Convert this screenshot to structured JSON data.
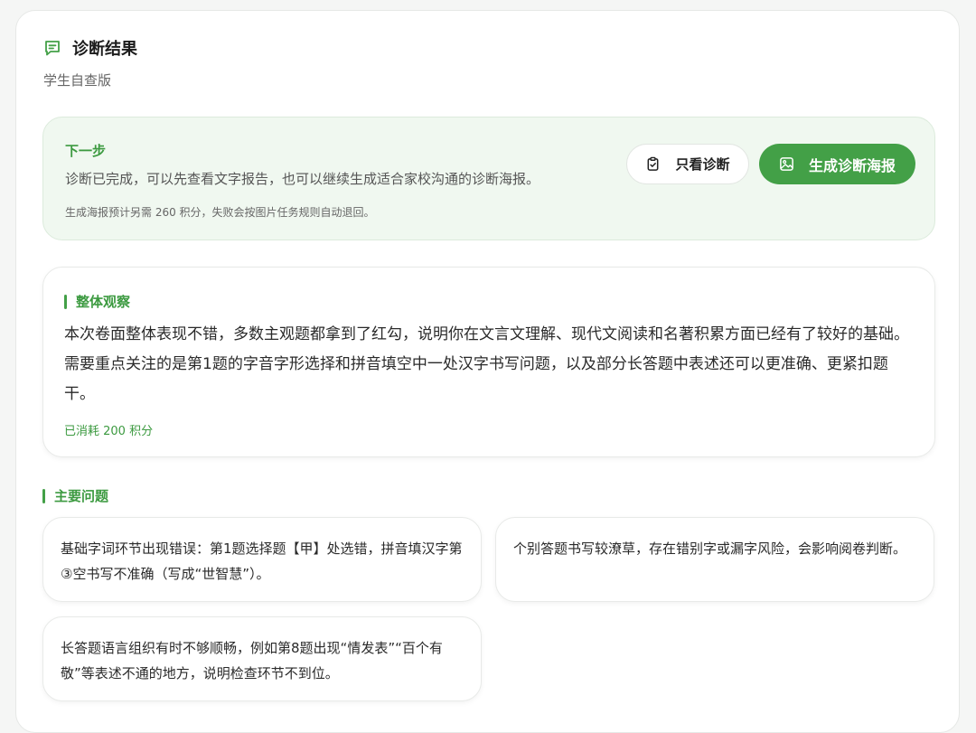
{
  "header": {
    "title": "诊断结果",
    "subtitle": "学生自查版"
  },
  "next_step": {
    "title": "下一步",
    "description": "诊断已完成，可以先查看文字报告，也可以继续生成适合家校沟通的诊断海报。",
    "note": "生成海报预计另需 260 积分，失败会按图片任务规则自动退回。",
    "view_button": "只看诊断",
    "generate_button": "生成诊断海报"
  },
  "overall": {
    "title": "整体观察",
    "text": "本次卷面整体表现不错，多数主观题都拿到了红勾，说明你在文言文理解、现代文阅读和名著积累方面已经有了较好的基础。需要重点关注的是第1题的字音字形选择和拼音填空中一处汉字书写问题，以及部分长答题中表述还可以更准确、更紧扣题干。",
    "cost": "已消耗 200 积分"
  },
  "issues": {
    "title": "主要问题",
    "items": [
      "基础字词环节出现错误：第1题选择题【甲】处选错，拼音填汉字第③空书写不准确（写成“世智慧”）。",
      "个别答题书写较潦草，存在错别字或漏字风险，会影响阅卷判断。",
      "长答题语言组织有时不够顺畅，例如第8题出现“情发表”“百个有敬”等表述不通的地方，说明检查环节不到位。"
    ]
  },
  "colors": {
    "accent": "#43a047",
    "accent_text": "#3c9a40",
    "panel_bg": "#f0f8f0"
  }
}
